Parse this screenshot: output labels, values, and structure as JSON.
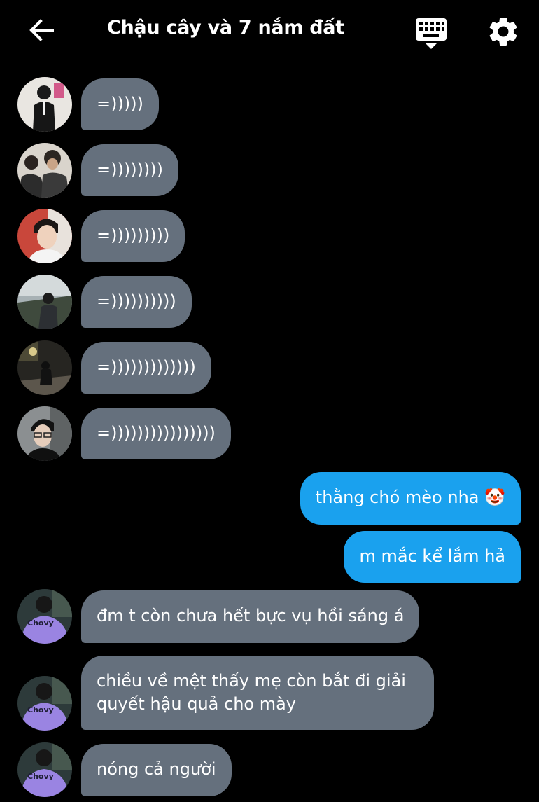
{
  "header": {
    "title": "Chậu cây và 7 nắm đất",
    "back_icon": "arrow-left-icon",
    "keyboard_icon": "keyboard-icon",
    "settings_icon": "gear-icon"
  },
  "colors": {
    "background": "#000000",
    "incoming_bubble": "#65707d",
    "outgoing_bubble": "#1aa1ee",
    "text": "#ffffff"
  },
  "messages": [
    {
      "direction": "in",
      "text": "=)))))",
      "avatar": "member-1"
    },
    {
      "direction": "in",
      "text": "=))))))))",
      "avatar": "member-2"
    },
    {
      "direction": "in",
      "text": "=)))))))))",
      "avatar": "member-3"
    },
    {
      "direction": "in",
      "text": "=))))))))))",
      "avatar": "member-4"
    },
    {
      "direction": "in",
      "text": "=)))))))))))))",
      "avatar": "member-5"
    },
    {
      "direction": "in",
      "text": "=))))))))))))))))",
      "avatar": "member-6"
    },
    {
      "direction": "out",
      "text": "thằng chó mèo nha 🤡"
    },
    {
      "direction": "out",
      "text": "m mắc kể lắm hả"
    },
    {
      "direction": "in",
      "text": "đm t còn chưa hết bực vụ hồi sáng á",
      "avatar": "member-7"
    },
    {
      "direction": "in",
      "text": "chiều về mệt thấy mẹ còn bắt đi giải quyết hậu quả cho mày",
      "avatar": "member-7"
    },
    {
      "direction": "in",
      "text": "nóng cả người",
      "avatar": "member-7"
    }
  ]
}
